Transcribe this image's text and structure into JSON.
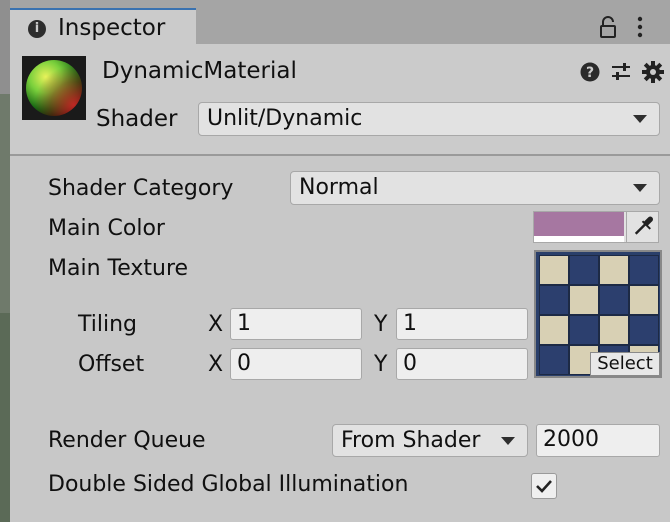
{
  "tab": {
    "title": "Inspector",
    "icon": "info-icon"
  },
  "header": {
    "material_name": "DynamicMaterial",
    "shader_label": "Shader",
    "shader_value": "Unlit/Dynamic"
  },
  "properties": {
    "shader_category": {
      "label": "Shader Category",
      "value": "Normal"
    },
    "main_color": {
      "label": "Main Color",
      "color": "#a677a1"
    },
    "main_texture": {
      "label": "Main Texture",
      "select_label": "Select",
      "tiling": {
        "label": "Tiling",
        "x_label": "X",
        "x": "1",
        "y_label": "Y",
        "y": "1"
      },
      "offset": {
        "label": "Offset",
        "x_label": "X",
        "x": "0",
        "y_label": "Y",
        "y": "0"
      }
    },
    "render_queue": {
      "label": "Render Queue",
      "mode": "From Shader",
      "value": "2000"
    },
    "double_sided_gi": {
      "label": "Double Sided Global Illumination",
      "checked": true
    }
  },
  "colors": {
    "accent": "#3a72b0",
    "panel": "#c8c8c8",
    "field": "#e2e2e2"
  }
}
